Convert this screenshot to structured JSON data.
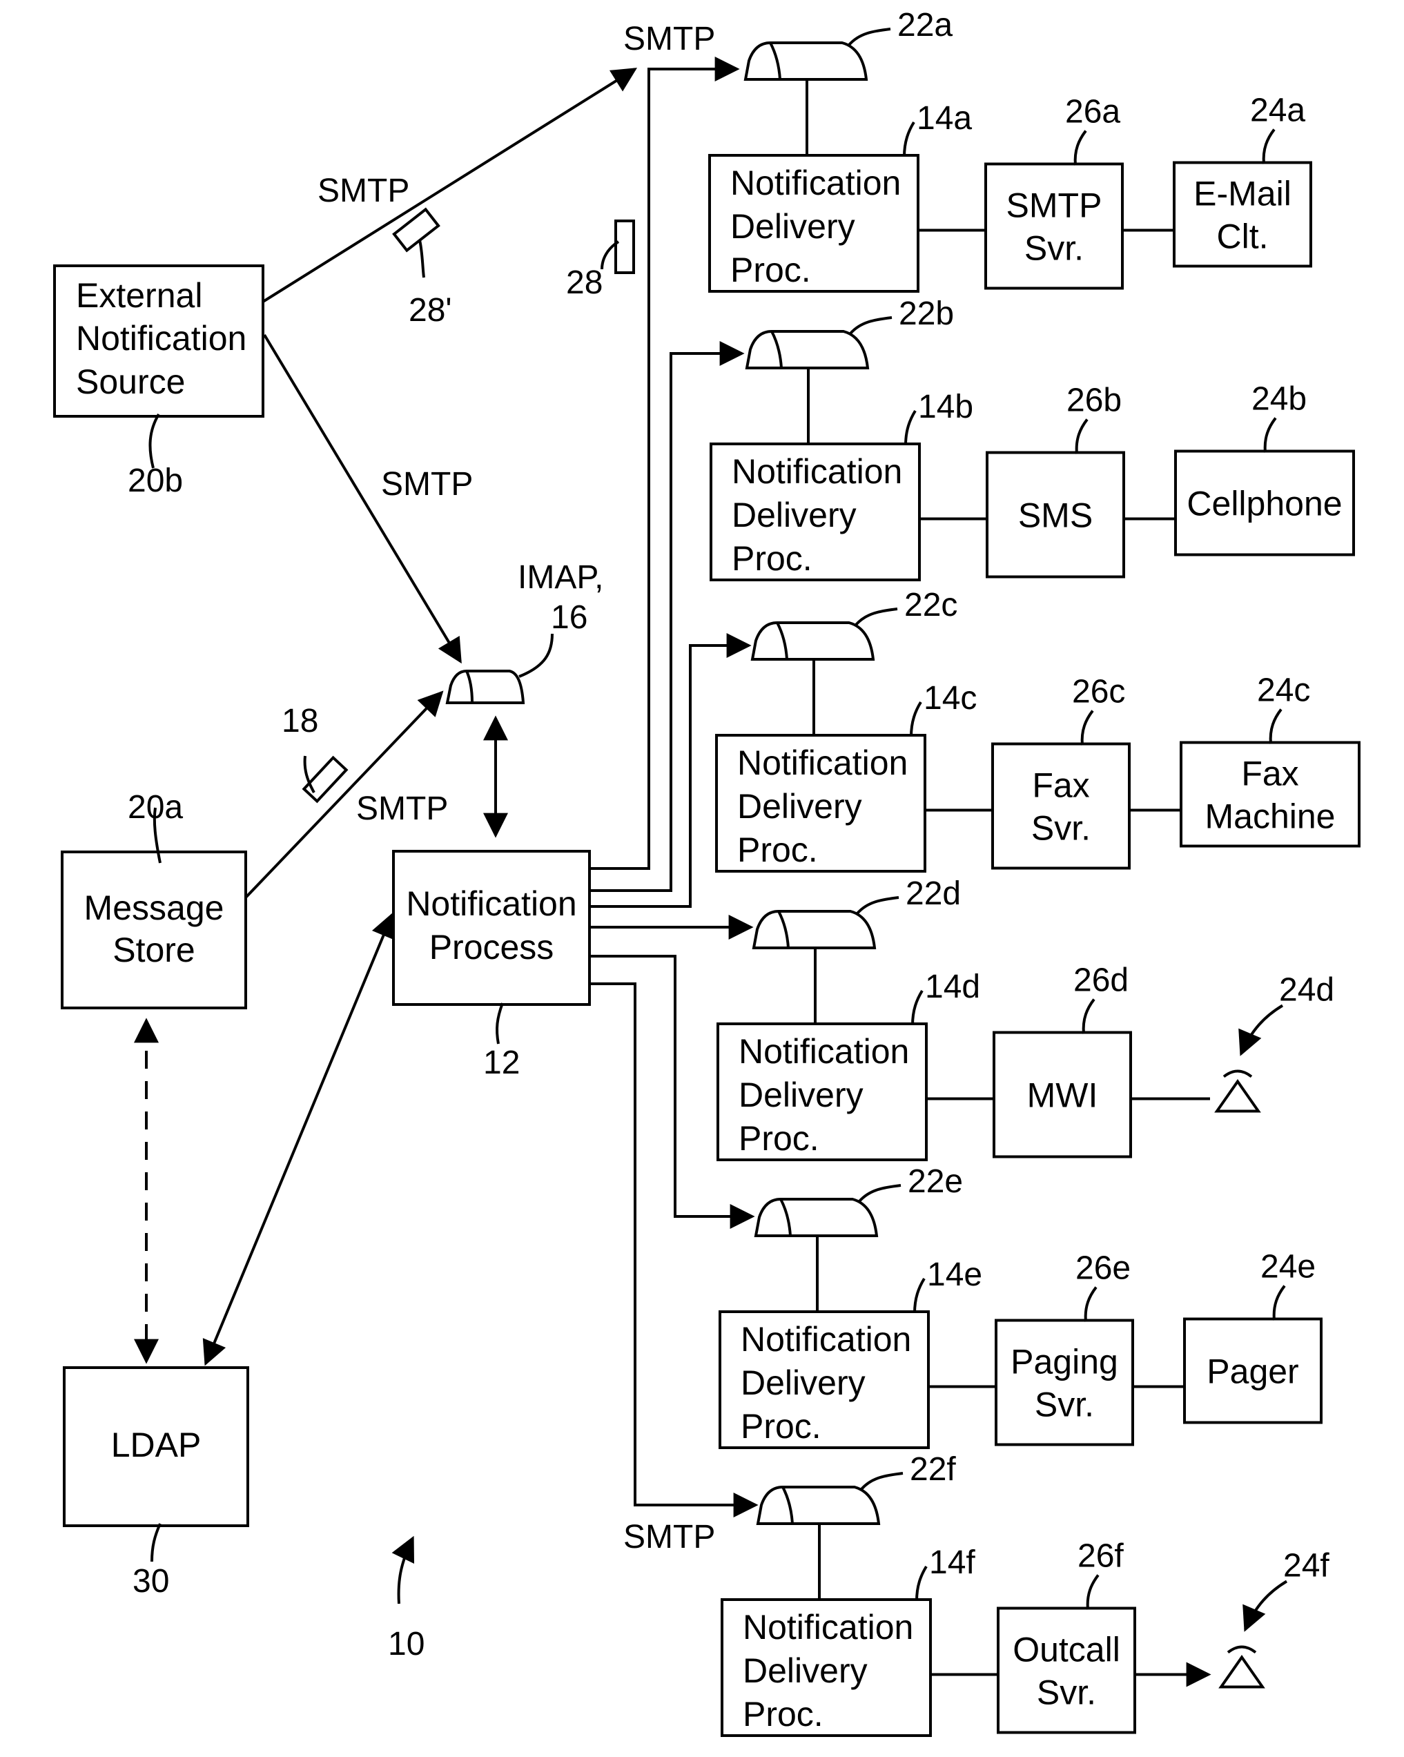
{
  "figure": {
    "reference": "10"
  },
  "protocol_labels": {
    "smtp_top": "SMTP",
    "smtp_upper_left": "SMTP",
    "smtp_middle": "SMTP",
    "smtp_store": "SMTP",
    "smtp_bottom": "SMTP",
    "imap_line1": "IMAP,",
    "imap_line2": "16"
  },
  "nodes": {
    "external_source": {
      "lines": [
        "External",
        "Notification",
        "Source"
      ],
      "ref": "20b"
    },
    "message_store": {
      "lines": [
        "Message",
        "Store"
      ],
      "ref": "20a"
    },
    "ldap": {
      "lines": [
        "LDAP"
      ],
      "ref": "30"
    },
    "notification_process": {
      "lines": [
        "Notification",
        "Process"
      ],
      "ref": "12"
    }
  },
  "messages": {
    "msg_18": "18",
    "msg_28": "28",
    "msg_28p": "28'"
  },
  "channels": [
    {
      "queue": "22a",
      "proc_ref": "14a",
      "proc_lines": [
        "Notification",
        "Delivery",
        "Proc."
      ],
      "server_ref": "26a",
      "server_lines": [
        "SMTP",
        "Svr."
      ],
      "device_ref": "24a",
      "device_lines": [
        "E-Mail",
        "Clt."
      ],
      "device_icon": ""
    },
    {
      "queue": "22b",
      "proc_ref": "14b",
      "proc_lines": [
        "Notification",
        "Delivery",
        "Proc."
      ],
      "server_ref": "26b",
      "server_lines": [
        "SMS"
      ],
      "device_ref": "24b",
      "device_lines": [
        "Cellphone"
      ],
      "device_icon": ""
    },
    {
      "queue": "22c",
      "proc_ref": "14c",
      "proc_lines": [
        "Notification",
        "Delivery",
        "Proc."
      ],
      "server_ref": "26c",
      "server_lines": [
        "Fax",
        "Svr."
      ],
      "device_ref": "24c",
      "device_lines": [
        "Fax",
        "Machine"
      ],
      "device_icon": ""
    },
    {
      "queue": "22d",
      "proc_ref": "14d",
      "proc_lines": [
        "Notification",
        "Delivery",
        "Proc."
      ],
      "server_ref": "26d",
      "server_lines": [
        "MWI"
      ],
      "device_ref": "24d",
      "device_lines": [],
      "device_icon": "telephone-icon"
    },
    {
      "queue": "22e",
      "proc_ref": "14e",
      "proc_lines": [
        "Notification",
        "Delivery",
        "Proc."
      ],
      "server_ref": "26e",
      "server_lines": [
        "Paging",
        "Svr."
      ],
      "device_ref": "24e",
      "device_lines": [
        "Pager"
      ],
      "device_icon": ""
    },
    {
      "queue": "22f",
      "proc_ref": "14f",
      "proc_lines": [
        "Notification",
        "Delivery",
        "Proc."
      ],
      "server_ref": "26f",
      "server_lines": [
        "Outcall",
        "Svr."
      ],
      "device_ref": "24f",
      "device_lines": [],
      "device_icon": "telephone-icon"
    }
  ]
}
